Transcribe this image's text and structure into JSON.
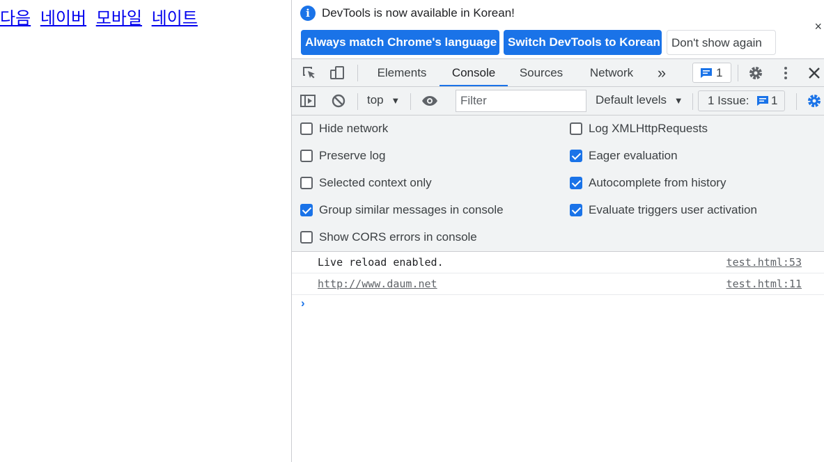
{
  "page": {
    "links": [
      "다음",
      "네이버",
      "모바일",
      "네이트"
    ]
  },
  "infobar": {
    "message": "DevTools is now available in Korean!",
    "btn_match": "Always match Chrome's language",
    "btn_switch": "Switch DevTools to Korean",
    "btn_dont_show": "Don't show again",
    "close": "×"
  },
  "tabs": {
    "elements": "Elements",
    "console": "Console",
    "sources": "Sources",
    "network": "Network",
    "more": "»",
    "message_count": "1"
  },
  "toolbar": {
    "context": "top",
    "filter_placeholder": "Filter",
    "levels": "Default levels",
    "issues_label": "1 Issue:",
    "issues_count": "1"
  },
  "settings": {
    "hide_network": {
      "label": "Hide network",
      "checked": false
    },
    "preserve_log": {
      "label": "Preserve log",
      "checked": false
    },
    "selected_context": {
      "label": "Selected context only",
      "checked": false
    },
    "group_similar": {
      "label": "Group similar messages in console",
      "checked": true
    },
    "show_cors": {
      "label": "Show CORS errors in console",
      "checked": false
    },
    "log_xhr": {
      "label": "Log XMLHttpRequests",
      "checked": false
    },
    "eager_eval": {
      "label": "Eager evaluation",
      "checked": true
    },
    "autocomplete": {
      "label": "Autocomplete from history",
      "checked": true
    },
    "evaluate_triggers": {
      "label": "Evaluate triggers user activation",
      "checked": true
    }
  },
  "console_log": [
    {
      "message": "Live reload enabled.",
      "source": "test.html:53"
    },
    {
      "message": "http://www.daum.net",
      "source": "test.html:11"
    }
  ],
  "colors": {
    "accent": "#1a73e8",
    "toolbar_bg": "#f1f3f4",
    "link": "#0000ee"
  }
}
